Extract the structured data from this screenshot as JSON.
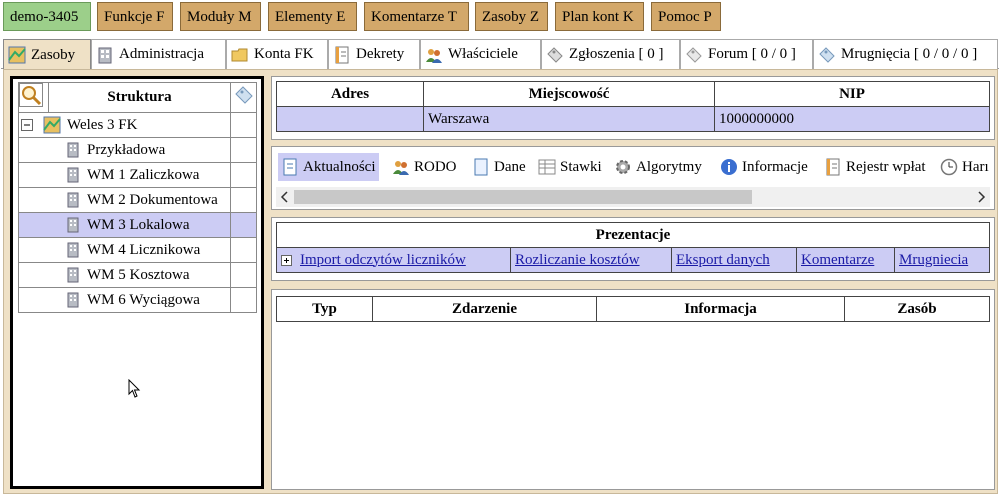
{
  "top_menu": [
    "demo-3405",
    "Funkcje F",
    "Moduły M",
    "Elementy E",
    "Komentarze T",
    "Zasoby Z",
    "Plan kont K",
    "Pomoc P"
  ],
  "tabs": [
    "Zasoby",
    "Administracja",
    "Konta FK",
    "Dekrety",
    "Właściciele",
    "Zgłoszenia [ 0 ]",
    "Forum [ 0 / 0 ]",
    "Mrugnięcia [ 0 / 0 / 0 ]"
  ],
  "tree": {
    "header": "Struktura",
    "root": "Weles 3 FK",
    "items": [
      "Przykładowa",
      "WM 1 Zaliczkowa",
      "WM 2 Dokumentowa",
      "WM 3 Lokalowa",
      "WM 4 Licznikowa",
      "WM 5 Kosztowa",
      "WM 6 Wyciągowa"
    ],
    "selected": "WM 3 Lokalowa"
  },
  "info_table": {
    "headers": [
      "Adres",
      "Miejscowość",
      "NIP"
    ],
    "row": [
      "",
      "Warszawa",
      "1000000000"
    ]
  },
  "subtabs": [
    "Aktualności",
    "RODO",
    "Dane",
    "Stawki",
    "Algorytmy",
    "Informacje",
    "Rejestr wpłat",
    "Harı"
  ],
  "presentations": {
    "title": "Prezentacje",
    "links": [
      "Import odczytów liczników",
      "Rozliczanie kosztów",
      "Eksport danych",
      "Komentarze",
      "Mrugniecia"
    ]
  },
  "events_table": {
    "headers": [
      "Typ",
      "Zdarzenie",
      "Informacja",
      "Zasób"
    ]
  }
}
